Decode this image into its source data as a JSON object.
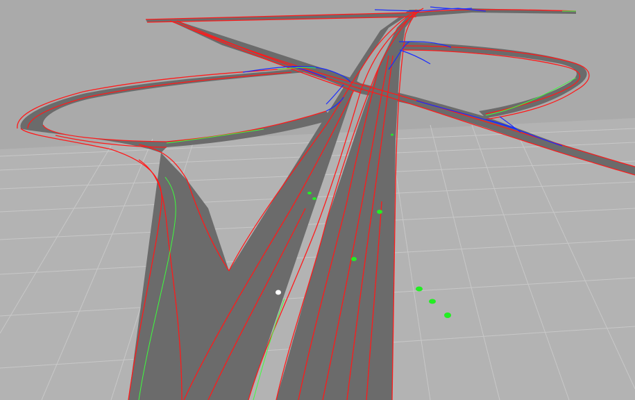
{
  "scene": {
    "kind": "3d-road-network-viewer",
    "colors": {
      "sky": "#aaaaaa",
      "ground": "#b4b4b4",
      "grid": "#c9c9c9",
      "road_surface": "#6b6b6b",
      "road_boundary": "#ff1a1a",
      "lane_link": "#1a2cff",
      "centerline": "#3cff3c",
      "marker": "#22ee22",
      "ego_marker": "#ffffff"
    },
    "markers": {
      "count_green": 8,
      "count_white": 1
    }
  }
}
